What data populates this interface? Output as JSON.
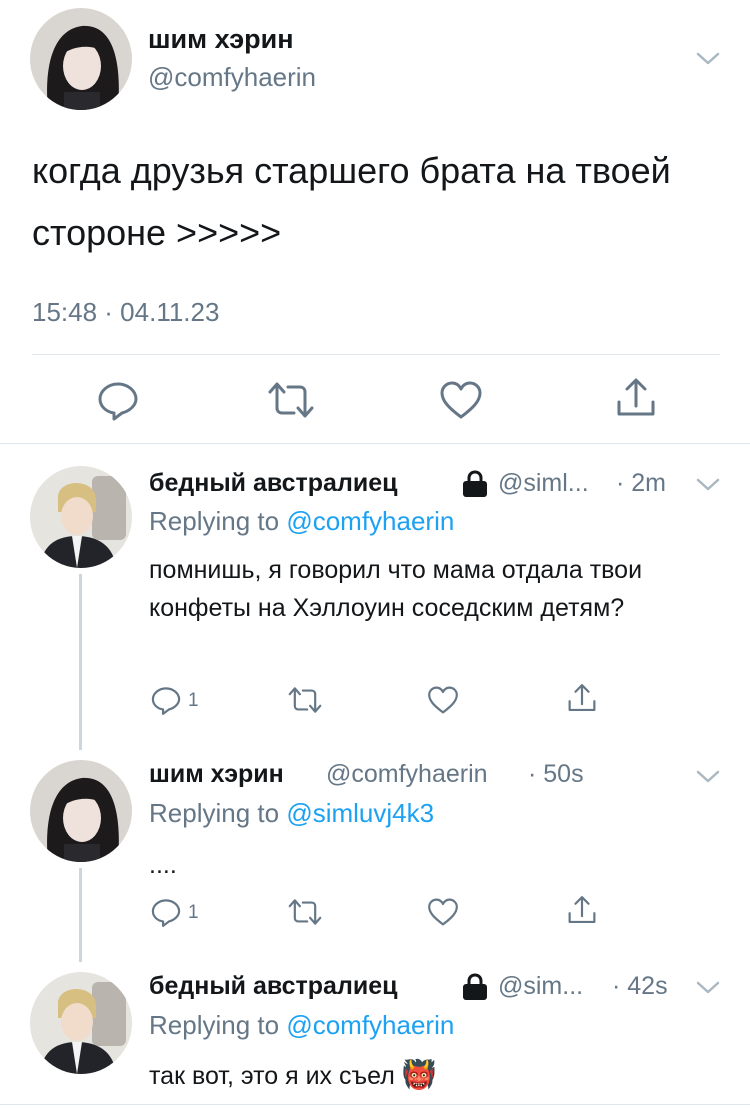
{
  "main_tweet": {
    "name": "шим хэрин",
    "handle": "@comfyhaerin",
    "text": "когда друзья старшего брата на твоей стороне >>>>>",
    "timestamp": "15:48 · 04.11.23"
  },
  "replies": [
    {
      "name": "бедный австралиец",
      "handle": "@siml...",
      "time": "· 2m",
      "replying_prefix": "Replying to",
      "replying_to": "@comfyhaerin",
      "text": "помнишь, я говорил что мама отдала твои конфеты на Хэллоуин соседским детям?",
      "reply_count": "1"
    },
    {
      "name": "шим хэрин",
      "handle": "@comfyhaerin",
      "time": "· 50s",
      "replying_prefix": "Replying to",
      "replying_to": "@simluvj4k3",
      "text": "....",
      "reply_count": "1"
    },
    {
      "name": "бедный австралиец",
      "handle": "@sim...",
      "time": "· 42s",
      "replying_prefix": "Replying to",
      "replying_to": "@comfyhaerin",
      "text": "так вот, это я их съел",
      "emoji": "👹"
    }
  ],
  "icons": {
    "reply": "reply-icon",
    "retweet": "retweet-icon",
    "like": "heart-icon",
    "share": "share-icon",
    "lock": "lock-icon",
    "more": "chevron-down-icon"
  },
  "colors": {
    "link": "#1da1f2",
    "secondary_text": "#657786",
    "icon": "#657786",
    "divider": "#e1e8ed",
    "thread_line": "#ccd6dd"
  }
}
